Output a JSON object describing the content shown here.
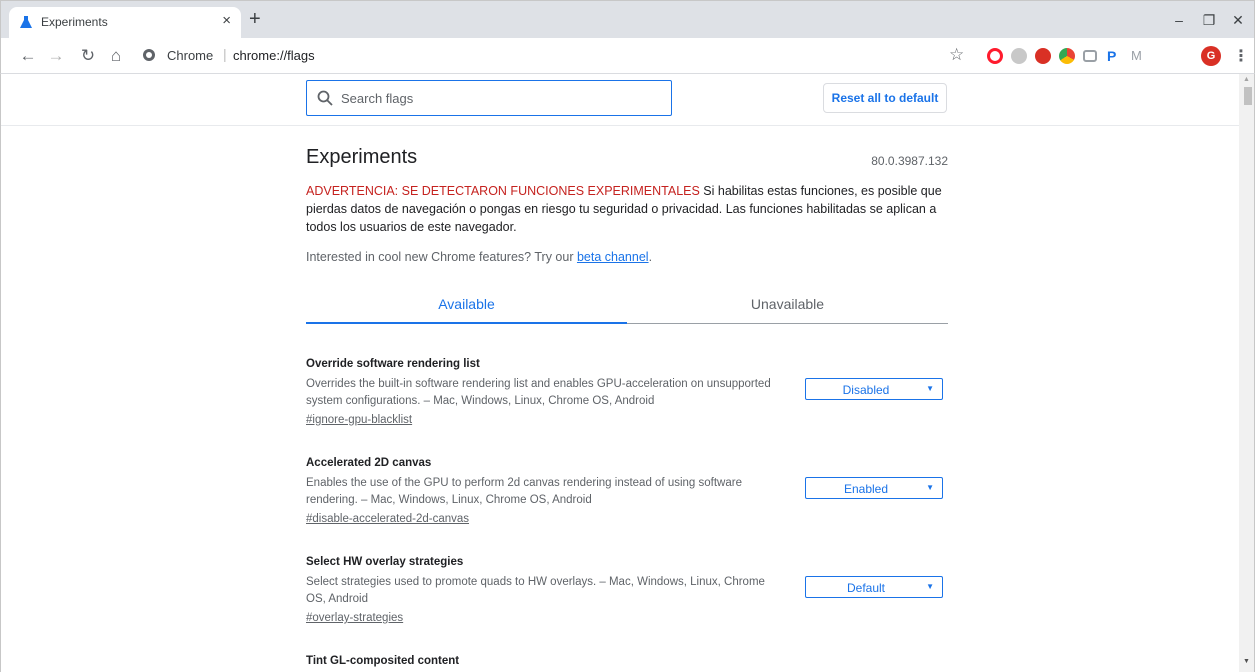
{
  "browser": {
    "tab_title": "Experiments",
    "tab_close": "×",
    "new_tab": "+",
    "omnibox_site": "Chrome",
    "omnibox_url": "chrome://flags",
    "profile_initial": "G"
  },
  "header": {
    "search_placeholder": "Search flags",
    "reset_label": "Reset all to default"
  },
  "main": {
    "title": "Experiments",
    "version": "80.0.3987.132",
    "warning_red": "ADVERTENCIA: SE DETECTARON FUNCIONES EXPERIMENTALES",
    "warning_rest": " Si habilitas estas funciones, es posible que pierdas datos de navegación o pongas en riesgo tu seguridad o privacidad. Las funciones habilitadas se aplican a todos los usuarios de este navegador.",
    "promo_text": "Interested in cool new Chrome features? Try our ",
    "promo_link": "beta channel",
    "promo_end": ".",
    "tabs": [
      "Available",
      "Unavailable"
    ]
  },
  "flags": [
    {
      "name": "Override software rendering list",
      "description": "Overrides the built-in software rendering list and enables GPU-acceleration on unsupported system configurations. – Mac, Windows, Linux, Chrome OS, Android",
      "link": "#ignore-gpu-blacklist",
      "value": "Disabled"
    },
    {
      "name": "Accelerated 2D canvas",
      "description": "Enables the use of the GPU to perform 2d canvas rendering instead of using software rendering. – Mac, Windows, Linux, Chrome OS, Android",
      "link": "#disable-accelerated-2d-canvas",
      "value": "Enabled"
    },
    {
      "name": "Select HW overlay strategies",
      "description": "Select strategies used to promote quads to HW overlays. – Mac, Windows, Linux, Chrome OS, Android",
      "link": "#overlay-strategies",
      "value": "Default"
    },
    {
      "name": "Tint GL-composited content"
    }
  ],
  "colors": {
    "accent": "#1a73e8",
    "warning": "#c5221f"
  }
}
